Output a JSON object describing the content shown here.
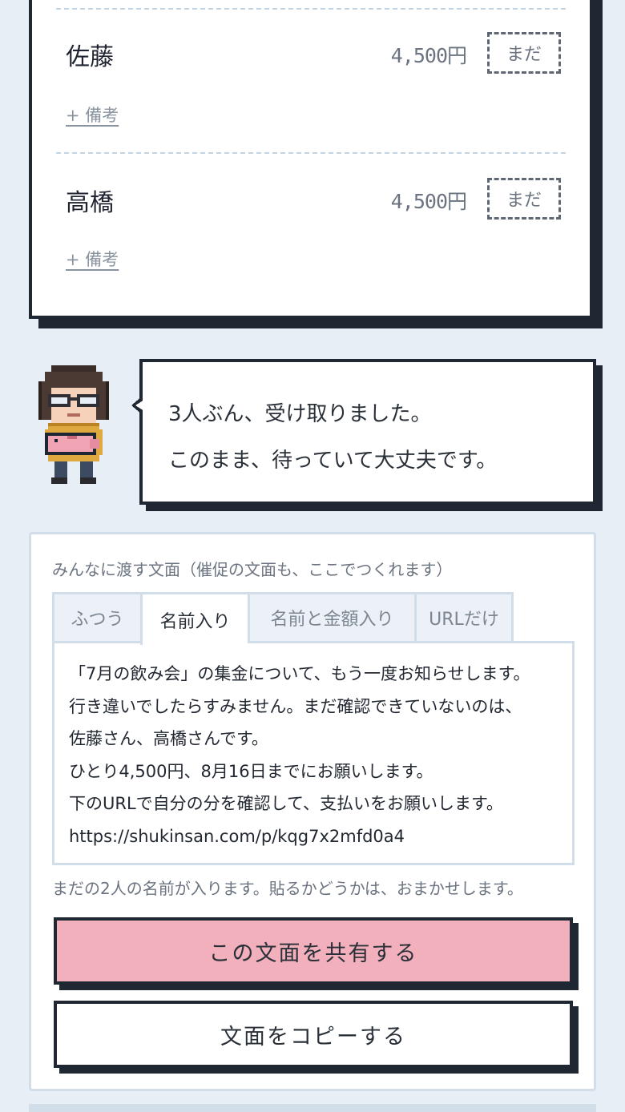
{
  "members": [
    {
      "name": "佐藤",
      "amount": "4,500円",
      "status": "まだ",
      "note_link": "+ 備考"
    },
    {
      "name": "高橋",
      "amount": "4,500円",
      "status": "まだ",
      "note_link": "+ 備考"
    }
  ],
  "bubble": {
    "line1": "3人ぶん、受け取りました。",
    "line2": "このまま、待っていて大丈夫です。"
  },
  "share": {
    "label": "みんなに渡す文面（催促の文面も、ここでつくれます）",
    "tabs": [
      {
        "label": "ふつう",
        "active": false
      },
      {
        "label": "名前入り",
        "active": true
      },
      {
        "label": "名前と金額入り",
        "active": false
      },
      {
        "label": "URLだけ",
        "active": false
      }
    ],
    "message_lines": [
      "「7月の飲み会」の集金について、もう一度お知らせします。",
      "行き違いでしたらすみません。まだ確認できていないのは、",
      "佐藤さん、高橋さんです。",
      "ひとり4,500円、8月16日までにお願いします。",
      "下のURLで自分の分を確認して、支払いをお願いします。",
      "https://shukinsan.com/p/kqg7x2mfd0a4"
    ],
    "hint": "まだの2人の名前が入ります。貼るかどうかは、おまかせします。",
    "share_button": "この文面を共有する",
    "copy_button": "文面をコピーする"
  },
  "colors": {
    "background": "#e8eef5",
    "border_dark": "#1f2733",
    "share_button": "#f2b0bc",
    "panel_border": "#d1dde8"
  },
  "icons": {
    "avatar": "pixel-character-holding-piggy-bank-icon"
  }
}
